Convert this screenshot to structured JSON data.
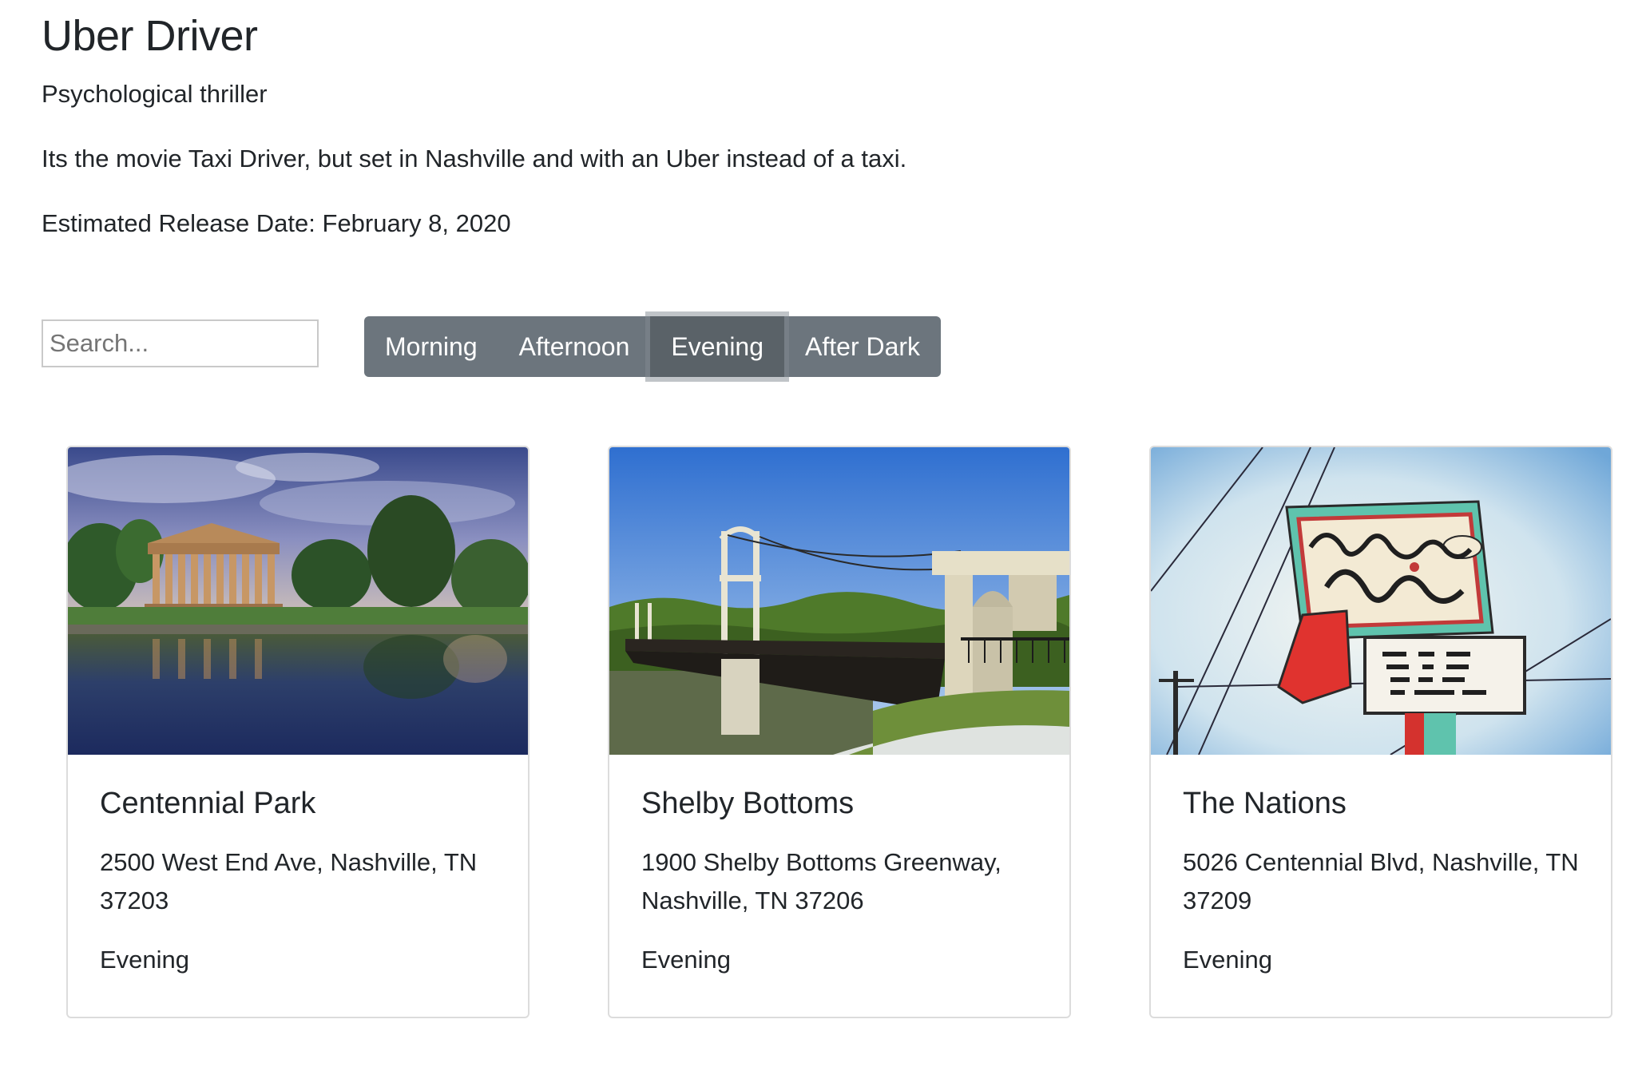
{
  "movie": {
    "title": "Uber Driver",
    "genre": "Psychological thriller",
    "description": "Its the movie Taxi Driver, but set in Nashville and with an Uber instead of a taxi.",
    "release": "Estimated Release Date: February 8, 2020"
  },
  "search": {
    "placeholder": "Search...",
    "value": ""
  },
  "filters": {
    "items": [
      {
        "label": "Morning"
      },
      {
        "label": "Afternoon"
      },
      {
        "label": "Evening"
      },
      {
        "label": "After Dark"
      }
    ],
    "selected": "Evening"
  },
  "locations": [
    {
      "name": "Centennial Park",
      "address": "2500 West End Ave, Nashville, TN 37203",
      "time": "Evening",
      "image": "parthenon-photo"
    },
    {
      "name": "Shelby Bottoms",
      "address": "1900 Shelby Bottoms Greenway, Nashville, TN 37206",
      "time": "Evening",
      "image": "bridge-photo"
    },
    {
      "name": "The Nations",
      "address": "5026 Centennial Blvd, Nashville, TN 37209",
      "time": "Evening",
      "image": "nations-sign-photo"
    }
  ],
  "colors": {
    "button_group": "#6c757d",
    "button_active": "#5a6268",
    "text": "#212529",
    "card_border": "#dcdcdc"
  }
}
